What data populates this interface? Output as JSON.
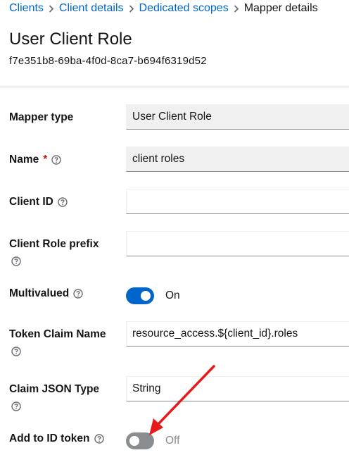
{
  "breadcrumb": {
    "items": [
      {
        "label": "Clients"
      },
      {
        "label": "Client details"
      },
      {
        "label": "Dedicated scopes"
      }
    ],
    "current": "Mapper details"
  },
  "page": {
    "title": "User Client Role",
    "id": "f7e351b8-69ba-4f0d-8ca7-b694f6319d52"
  },
  "form": {
    "mapper_type": {
      "label": "Mapper type",
      "value": "User Client Role"
    },
    "name": {
      "label": "Name",
      "required_marker": "*",
      "value": "client roles"
    },
    "client_id": {
      "label": "Client ID",
      "value": ""
    },
    "client_role_prefix": {
      "label": "Client Role prefix",
      "value": ""
    },
    "multivalued": {
      "label": "Multivalued",
      "state": "On",
      "checked": true
    },
    "token_claim_name": {
      "label": "Token Claim Name",
      "value": "resource_access.${client_id}.roles"
    },
    "claim_json_type": {
      "label": "Claim JSON Type",
      "value": "String"
    },
    "add_to_id_token": {
      "label": "Add to ID token",
      "state": "Off",
      "checked": false
    }
  },
  "colors": {
    "link": "#0066cc",
    "switch_on": "#0066cc",
    "switch_off": "#8a8d90",
    "required": "#c9190b",
    "arrow": "#e8191a"
  },
  "icons": {
    "help": "help-circle-icon",
    "separator": "chevron-right-icon"
  }
}
